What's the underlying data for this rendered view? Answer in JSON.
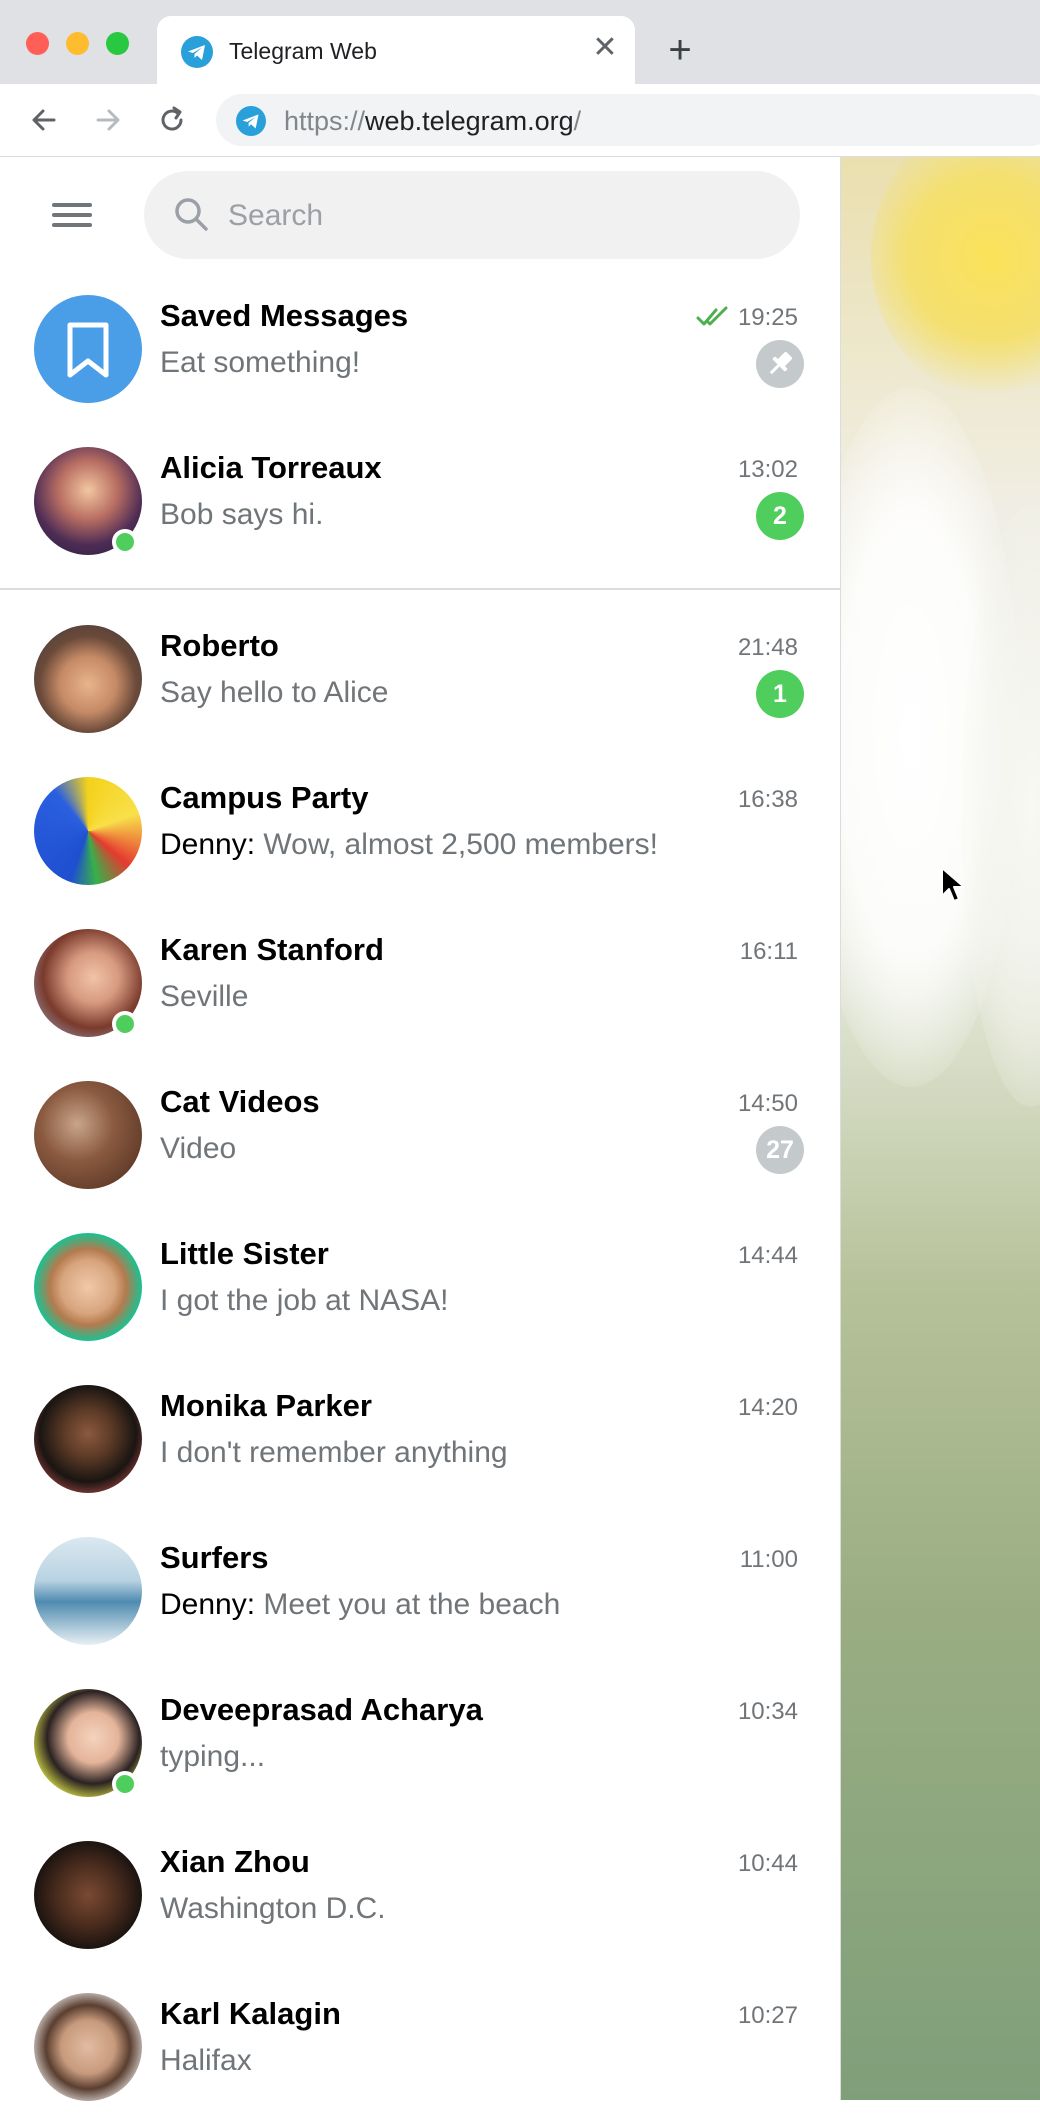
{
  "browser": {
    "tab_title": "Telegram Web",
    "url_scheme": "https://",
    "url_host": "web.telegram.org",
    "url_path": "/",
    "accent": "#2aa0db"
  },
  "search": {
    "placeholder": "Search"
  },
  "colors": {
    "online": "#4fce5d",
    "badge_unread": "#4fce5d",
    "badge_muted": "#c4c9cc",
    "saved_avatar": "#4a9ee8"
  },
  "chats": [
    {
      "name": "Saved Messages",
      "time": "19:25",
      "message": "Eat something!",
      "read_checks": true,
      "pinned": true,
      "avatar": "bookmark-icon"
    },
    {
      "name": "Alicia Torreaux",
      "time": "13:02",
      "message": "Bob says hi.",
      "badge": "2",
      "online": true
    },
    {
      "name": "Roberto",
      "time": "21:48",
      "message": "Say hello to Alice",
      "badge": "1"
    },
    {
      "name": "Campus Party",
      "time": "16:38",
      "sender": "Denny:",
      "message": "Wow, almost 2,500 members!"
    },
    {
      "name": "Karen Stanford",
      "time": "16:11",
      "message": "Seville",
      "online": true
    },
    {
      "name": "Cat Videos",
      "time": "14:50",
      "message": "Video",
      "badge": "27",
      "muted": true
    },
    {
      "name": "Little Sister",
      "time": "14:44",
      "message": "I got the job at NASA!"
    },
    {
      "name": "Monika Parker",
      "time": "14:20",
      "message": "I don't remember anything"
    },
    {
      "name": "Surfers",
      "time": "11:00",
      "sender": "Denny:",
      "message": "Meet you at the beach"
    },
    {
      "name": "Deveeprasad Acharya",
      "time": "10:34",
      "message": "typing...",
      "online": true
    },
    {
      "name": "Xian Zhou",
      "time": "10:44",
      "message": "Washington D.C."
    },
    {
      "name": "Karl Kalagin",
      "time": "10:27",
      "message": "Halifax"
    }
  ]
}
